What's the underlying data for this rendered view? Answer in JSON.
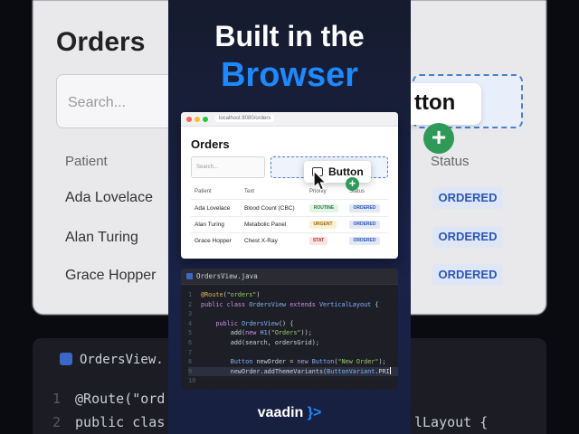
{
  "headline": {
    "line1": "Built in the",
    "line2": "Browser"
  },
  "browser": {
    "url": "localhost:8080/orders",
    "title": "Orders",
    "search_placeholder": "Search...",
    "button_label": "Button",
    "columns": [
      "Patient",
      "Text",
      "Priority",
      "Status"
    ],
    "rows": [
      {
        "patient": "Ada Lovelace",
        "text": "Blood Count (CBC)",
        "priority": "ROUTINE",
        "status": "ORDERED"
      },
      {
        "patient": "Alan Turing",
        "text": "Metabolic Panel",
        "priority": "URGENT",
        "status": "ORDERED"
      },
      {
        "patient": "Grace Hopper",
        "text": "Chest X-Ray",
        "priority": "STAT",
        "status": "ORDERED"
      }
    ]
  },
  "editor": {
    "file_name": "OrdersView.java",
    "line_numbers": [
      "1",
      "2",
      "3",
      "4",
      "5",
      "6",
      "7",
      "8",
      "9",
      "10"
    ]
  },
  "background": {
    "title": "Orders",
    "search_placeholder": "Search...",
    "button_fragment": "tton",
    "col_patient": "Patient",
    "col_status": "Status",
    "rows": [
      "Ada Lovelace",
      "Alan Turing",
      "Grace Hopper"
    ],
    "status": "ORDERED",
    "file_name": "OrdersView.",
    "code1": "@Route(\"ord",
    "code2": "public clas",
    "code2b": "lLayout {",
    "ln1": "1",
    "ln2": "2"
  },
  "logo": {
    "text": "vaadin",
    "mark": "}>"
  },
  "colors": {
    "accent": "#1e88ff",
    "success": "#2f9a58",
    "panel": "#1a2349"
  }
}
